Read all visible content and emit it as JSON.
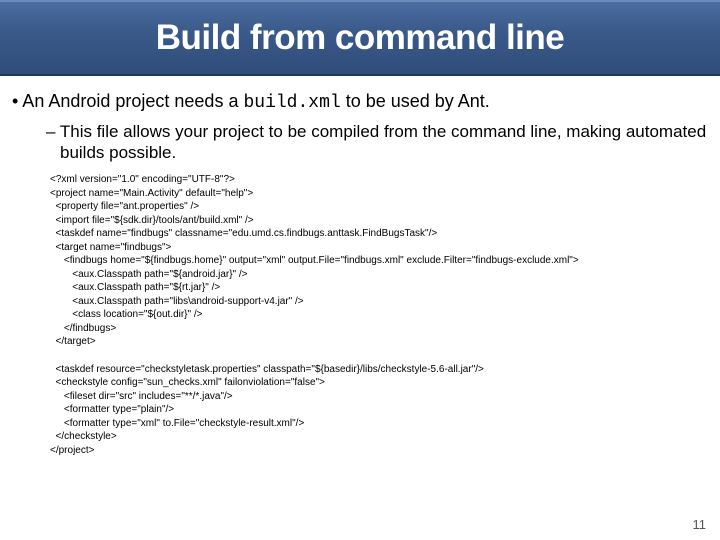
{
  "title": "Build from command line",
  "bullet_pre": "• An Android project needs a ",
  "bullet_code": "build.xml",
  "bullet_post": " to be used by Ant.",
  "dash": "– This file allows your project to be compiled from the command line, making automated builds possible.",
  "code1": "<?xml version=\"1.0\" encoding=\"UTF-8\"?>\n<project name=\"Main.Activity\" default=\"help\">\n  <property file=\"ant.properties\" />\n  <import file=\"${sdk.dir}/tools/ant/build.xml\" />\n  <taskdef name=\"findbugs\" classname=\"edu.umd.cs.findbugs.anttask.FindBugsTask\"/>\n  <target name=\"findbugs\">\n     <findbugs home=\"${findbugs.home}\" output=\"xml\" output.File=\"findbugs.xml\" exclude.Filter=\"findbugs-exclude.xml\">\n        <aux.Classpath path=\"${android.jar}\" />\n        <aux.Classpath path=\"${rt.jar}\" />\n        <aux.Classpath path=\"libs\\android-support-v4.jar\" />\n        <class location=\"${out.dir}\" />\n     </findbugs>\n  </target>",
  "code2": "  <taskdef resource=\"checkstyletask.properties\" classpath=\"${basedir}/libs/checkstyle-5.6-all.jar\"/>\n  <checkstyle config=\"sun_checks.xml\" failonviolation=\"false\">\n     <fileset dir=\"src\" includes=\"**/*.java\"/>\n     <formatter type=\"plain\"/>\n     <formatter type=\"xml\" to.File=\"checkstyle-result.xml\"/>\n  </checkstyle>\n</project>",
  "page_number": "11"
}
